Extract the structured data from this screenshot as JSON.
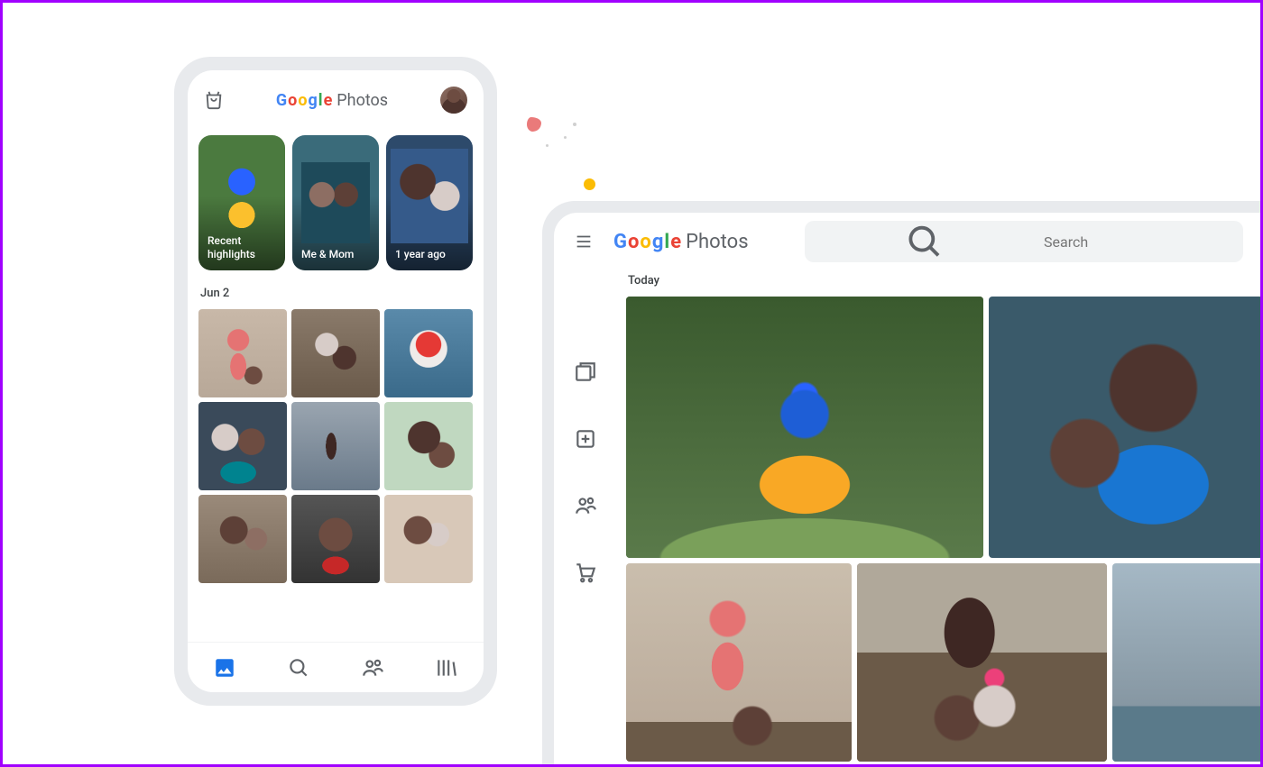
{
  "app_name_letters": [
    "G",
    "o",
    "o",
    "g",
    "l",
    "e"
  ],
  "app_name_word": "Photos",
  "mobile": {
    "memories": [
      {
        "label": "Recent highlights"
      },
      {
        "label": "Me & Mom"
      },
      {
        "label": "1 year ago"
      }
    ],
    "section_date": "Jun 2",
    "nav": {
      "photos": "photos-icon",
      "search": "search-icon",
      "sharing": "sharing-icon",
      "library": "library-icon"
    }
  },
  "desktop": {
    "search_placeholder": "Search",
    "section_date": "Today",
    "rail": {
      "photos": "photos-icon",
      "explore": "explore-icon",
      "utilities": "utilities-icon",
      "sharing": "sharing-icon",
      "print": "print-store-icon"
    }
  }
}
